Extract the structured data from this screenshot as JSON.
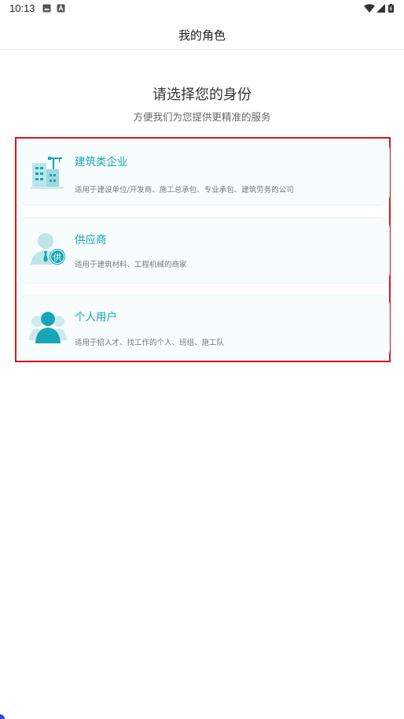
{
  "status_bar": {
    "time": "10:13"
  },
  "header": {
    "title": "我的角色"
  },
  "main": {
    "heading": "请选择您的身份",
    "subheading": "方便我们为您提供更精准的服务",
    "roles": [
      {
        "title": "建筑类企业",
        "description": "适用于建设单位/开发商、施工总承包、专业承包、建筑劳务的公司",
        "icon": "building-crane-icon"
      },
      {
        "title": "供应商",
        "description": "适用于建筑材料、工程机械的商家",
        "icon": "supplier-person-icon",
        "badge": "供"
      },
      {
        "title": "个人用户",
        "description": "适用于招人才、找工作的个人、班组、施工队",
        "icon": "individual-user-icon"
      }
    ]
  },
  "colors": {
    "accent": "#17a6b6",
    "icon_light": "#bde5ea",
    "highlight_border": "#d6161e"
  }
}
